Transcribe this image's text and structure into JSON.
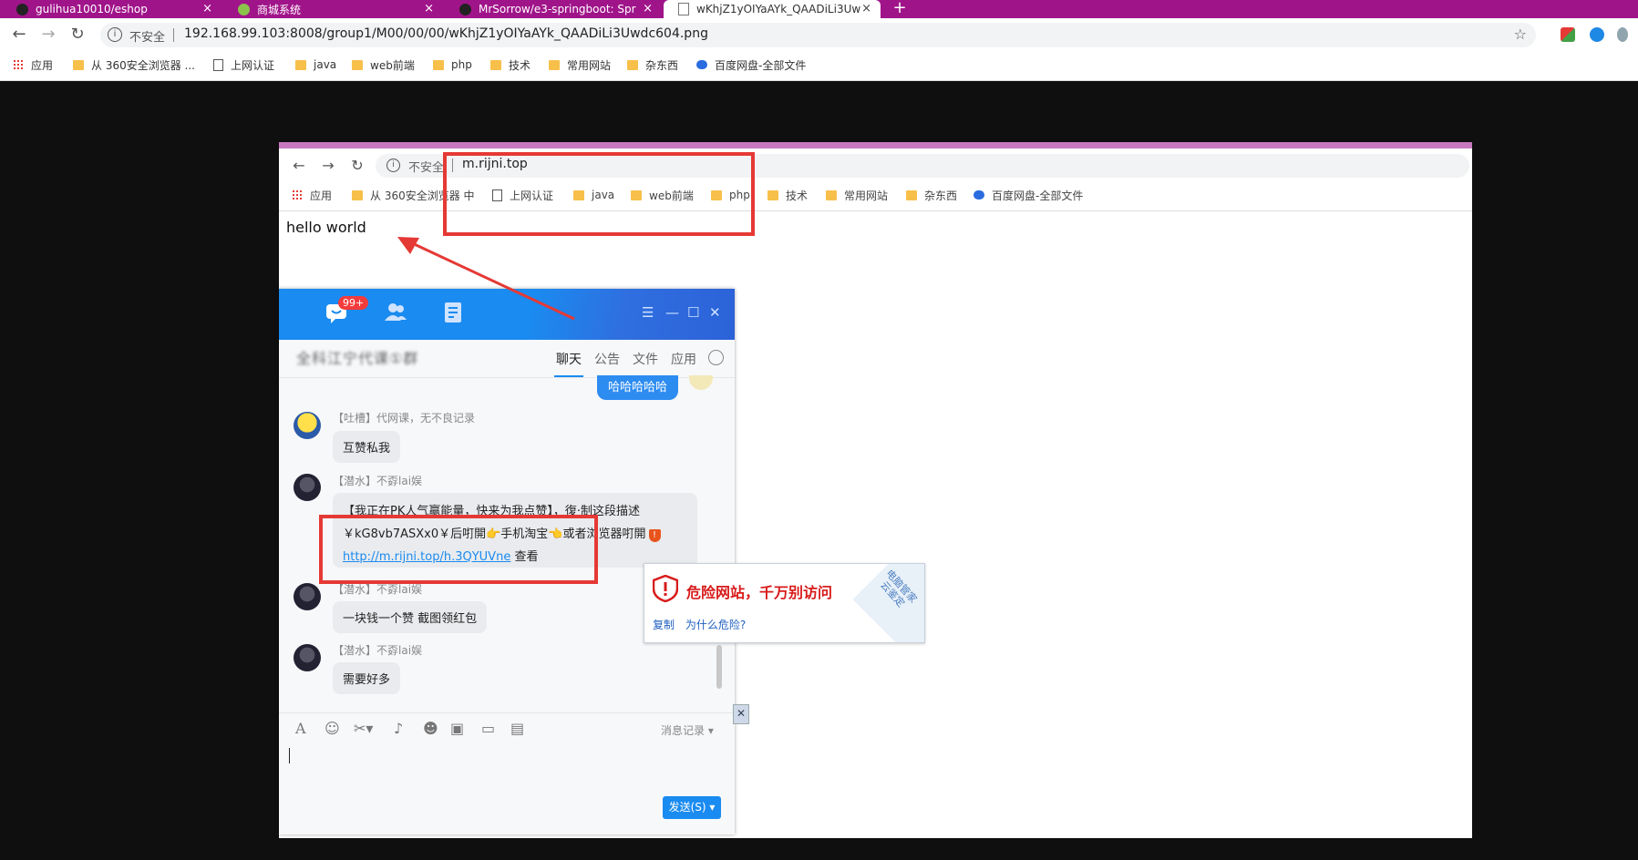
{
  "browser": {
    "tabs": [
      {
        "title": "gulihua10010/eshop",
        "close": "×"
      },
      {
        "title": "商城系统",
        "close": "×"
      },
      {
        "title": "MrSorrow/e3-springboot: Spr",
        "close": "×"
      },
      {
        "title": "wKhjZ1yOIYaAYk_QAADiLi3Uw",
        "close": "×"
      }
    ],
    "new_tab": "+",
    "insecure_label": "不安全",
    "url": "192.168.99.103:8008/group1/M00/00/00/wKhjZ1yOIYaAYk_QAADiLi3Uwdc604.png",
    "bookmarks": [
      "应用",
      "从 360安全浏览器 ...",
      "上网认证",
      "java",
      "web前端",
      "php",
      "技术",
      "常用网站",
      "杂东西",
      "百度网盘-全部文件"
    ]
  },
  "inner_browser": {
    "insecure_label": "不安全",
    "url": "m.rijni.top",
    "bookmarks": [
      "应用",
      "从 360安全浏览器 中",
      "上网认证",
      "java",
      "web前端",
      "php",
      "技术",
      "常用网站",
      "杂东西",
      "百度网盘-全部文件"
    ],
    "page_text": "hello world"
  },
  "qq": {
    "badge": "99+",
    "group_name": "全科江宁代课①群",
    "tabs": [
      "聊天",
      "公告",
      "文件",
      "应用"
    ],
    "my_message": "哈哈哈哈哈",
    "messages": [
      {
        "sender": "【吐槽】代网课，无不良记录",
        "text": "互赞私我"
      },
      {
        "sender": "【潜水】不孬lai娱",
        "line1": "【我正在PK人气赢能量，快来为我点赞】，復·制这段描述",
        "line2": "￥kG8vb7ASXx0￥后咑開",
        "line2b": "手机淘宝",
        "line2c": "或者",
        "line2d": "浏览器咑開",
        "link": "http://m.rijni.top/h.3QYUVne",
        "link_suffix": " 查看"
      },
      {
        "sender": "【潜水】不孬lai娱",
        "text": "一块钱一个赞 截图领红包"
      },
      {
        "sender": "【潜水】不孬lai娱",
        "text": "需要好多"
      }
    ],
    "msg_log": "消息记录",
    "send_button": "发送(S)"
  },
  "danger_popup": {
    "title": "危险网站，千万别访问",
    "copy": "复制",
    "why": "为什么危险?",
    "stamp": "电脑管家 云鉴定"
  },
  "colors": {
    "tabstrip": "#a0148a",
    "qq_blue": "#1a8bf0",
    "annotation_red": "#e53935",
    "danger_red": "#d81b1b"
  }
}
